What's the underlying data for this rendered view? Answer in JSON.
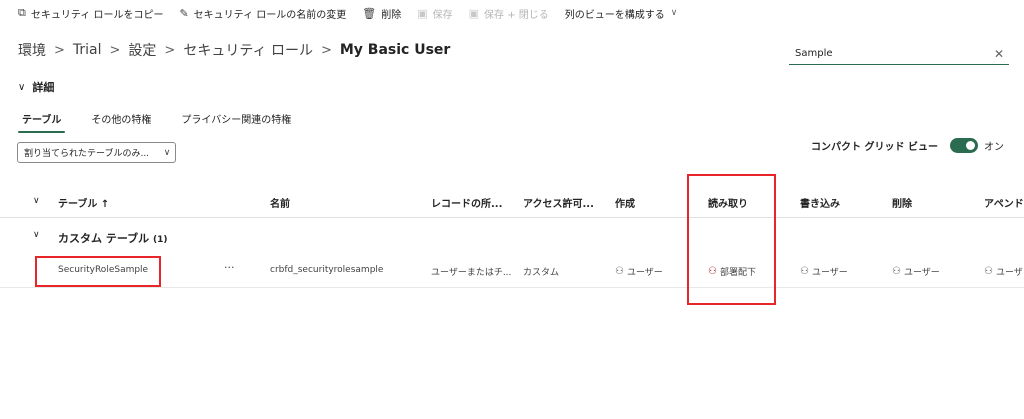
{
  "toolbar": {
    "copy_label": "セキュリティ ロールをコピー",
    "rename_label": "セキュリティ ロールの名前の変更",
    "delete_label": "削除",
    "save_label": "保存",
    "save_close_label": "保存 + 閉じる",
    "configure_view_label": "列のビューを構成する"
  },
  "breadcrumb": [
    "環境",
    "Trial",
    "設定",
    "セキュリティ ロール",
    "My Basic User"
  ],
  "search": {
    "value": "Sample"
  },
  "details": {
    "label": "詳細"
  },
  "tabs": [
    "テーブル",
    "その他の特権",
    "プライバシー関連の特権"
  ],
  "filter": {
    "value": "割り当てられたテーブルのみ..."
  },
  "compact_grid": {
    "label": "コンパクト グリッド ビュー",
    "state": "オン"
  },
  "grid": {
    "headers": {
      "table": "テーブル ↑",
      "name": "名前",
      "record_owner": "レコードの所...",
      "access": "アクセス許可...",
      "create": "作成",
      "read": "読み取り",
      "write": "書き込み",
      "delete": "削除",
      "append": "アペンド"
    },
    "group": {
      "label": "カスタム テーブル",
      "count": "(1)"
    },
    "rows": [
      {
        "table": "SecurityRoleSample",
        "more": "···",
        "name": "crbfd_securityrolesample",
        "record_owner": "ユーザーまたはチ...",
        "access": "カスタム",
        "create": "ユーザー",
        "read": "部署配下",
        "write": "ユーザー",
        "delete": "ユーザー",
        "append": "ユーザ"
      }
    ]
  },
  "colors": {
    "accent": "#2b6b4f",
    "highlight": "#e8262a"
  },
  "icons": [
    "copy-icon",
    "pencil-icon",
    "trash-icon",
    "save-icon",
    "save-close-icon",
    "chevron-down-icon",
    "close-icon",
    "person-icon",
    "people-icon"
  ]
}
